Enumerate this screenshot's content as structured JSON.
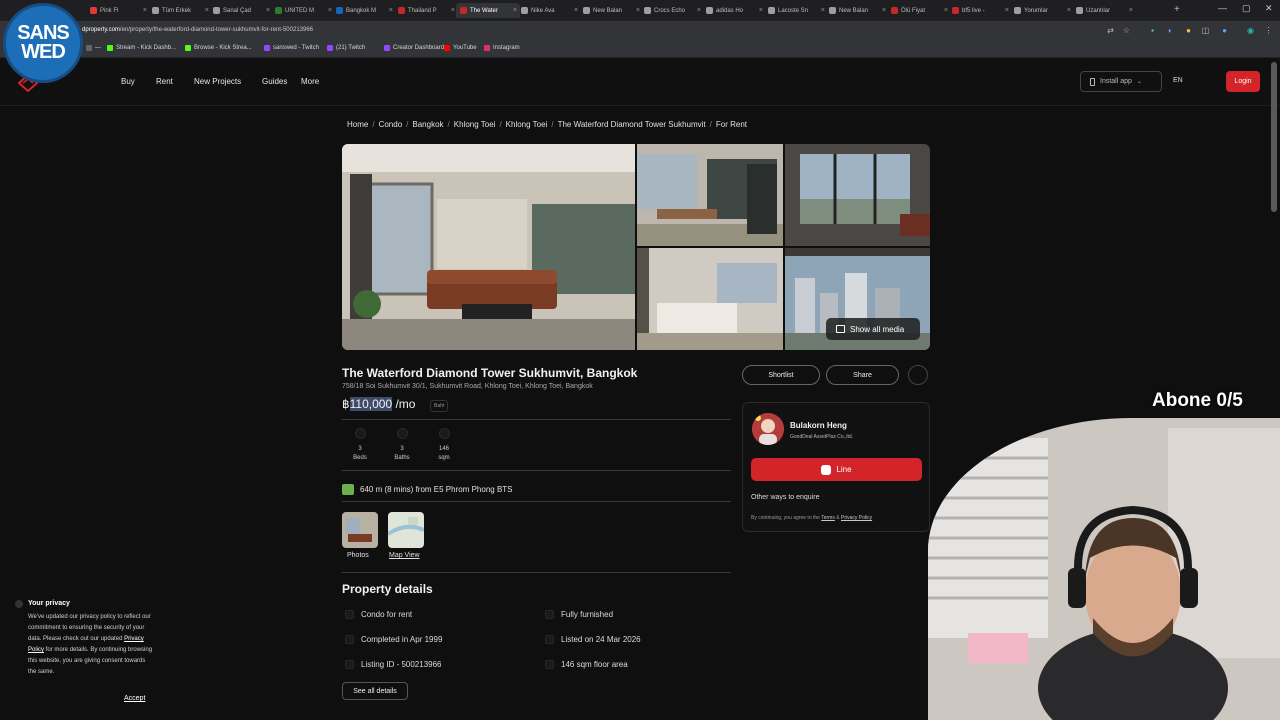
{
  "browser": {
    "tabs": [
      {
        "label": "Pink Fl",
        "color": "#e53935"
      },
      {
        "label": "Tüm Erkek",
        "color": "#9e9e9e"
      },
      {
        "label": "Sanal Çad",
        "color": "#9e9e9e"
      },
      {
        "label": "UNITED M",
        "color": "#2e7d32"
      },
      {
        "label": "Bangkok M",
        "color": "#1565c0"
      },
      {
        "label": "Thailand P",
        "color": "#c62828"
      },
      {
        "label": "The Water",
        "color": "#c62828",
        "active": true
      },
      {
        "label": "Nike Ava",
        "color": "#9e9e9e"
      },
      {
        "label": "New Balan",
        "color": "#9e9e9e"
      },
      {
        "label": "Crocs Echo",
        "color": "#9e9e9e"
      },
      {
        "label": "adidas Ho",
        "color": "#9e9e9e"
      },
      {
        "label": "Lacoste Sn",
        "color": "#9e9e9e"
      },
      {
        "label": "New Balan",
        "color": "#9e9e9e"
      },
      {
        "label": "Ölü Fiyat",
        "color": "#c62828"
      },
      {
        "label": "bf5 live -",
        "color": "#c62828"
      },
      {
        "label": "Yorumlar",
        "color": "#9e9e9e"
      },
      {
        "label": "Uzantılar",
        "color": "#9e9e9e"
      }
    ],
    "url_domain": "dproperty.com",
    "url_path": "/en/property/the-waterford-diamond-tower-sukhumvit-for-rent-500213966",
    "bookmarks": [
      {
        "label": "—",
        "color": "#666"
      },
      {
        "label": "Stream - Kick Dashb...",
        "color": "#53fc18"
      },
      {
        "label": "Browse - Kick Strea...",
        "color": "#53fc18"
      },
      {
        "label": "sanswed - Twitch",
        "color": "#9146ff"
      },
      {
        "label": "(21) Twitch",
        "color": "#9146ff"
      },
      {
        "label": "Creator Dashboard",
        "color": "#9146ff"
      },
      {
        "label": "YouTube",
        "color": "#ff0000"
      },
      {
        "label": "Instagram",
        "color": "#e1306c"
      }
    ]
  },
  "overlay": {
    "logo_line1": "SANS",
    "logo_line2": "WED",
    "subs_counter": "Abone 0/5"
  },
  "header": {
    "nav": [
      "Buy",
      "Rent",
      "New Projects",
      "Guides",
      "More"
    ],
    "install_app": "Install app",
    "lang": "EN",
    "login": "Login",
    "accent": "#d3242a"
  },
  "breadcrumb": [
    "Home",
    "Condo",
    "Bangkok",
    "Khlong Toei",
    "Khlong Toei",
    "The Waterford Diamond Tower Sukhumvit",
    "For Rent"
  ],
  "gallery": {
    "show_all_media": "Show all media"
  },
  "listing": {
    "title": "The Waterford Diamond Tower Sukhumvit, Bangkok",
    "address": "758/18 Soi Sukhumvit 30/1, Sukhumvit Road, Khlong Toei, Khlong Toei, Bangkok",
    "price_symbol": "฿",
    "price_value": "110,000",
    "price_suffix": " /mo",
    "currency_tag": "Baht",
    "features": [
      {
        "value": "3",
        "label": "Beds",
        "icon": "bed-icon"
      },
      {
        "value": "3",
        "label": "Baths",
        "icon": "bath-icon"
      },
      {
        "value": "146",
        "label": "sqm",
        "icon": "area-icon"
      }
    ],
    "transit": "640 m (8 mins) from E5 Phrom Phong BTS",
    "thumbs": [
      {
        "label": "Photos"
      },
      {
        "label": "Map View"
      }
    ]
  },
  "actions": {
    "shortlist": "Shortlist",
    "share": "Share"
  },
  "agent": {
    "name": "Bulakorn Heng",
    "company": "GoodDeal AssetPlus Co.,ltd.",
    "line_button": "Line",
    "other_ways": "Other ways to enquire",
    "terms_prefix": "By continuing, you agree to the ",
    "terms_link": "Terms",
    "terms_and": " & ",
    "privacy_link": "Privacy Policy"
  },
  "details": {
    "title": "Property details",
    "items": [
      "Condo for rent",
      "Fully furnished",
      "Completed in Apr 1999",
      "Listed on 24 Mar 2026",
      "Listing ID - 500213966",
      "146 sqm floor area"
    ],
    "see_all": "See all details"
  },
  "privacy_notice": {
    "title": "Your privacy",
    "body_1": "We've updated our privacy policy to reflect our commitment to ensuring the security of your data. Please check out our updated ",
    "link": "Privacy Policy",
    "body_2": " for more details. By continuing browsing this website, you are giving consent towards the same.",
    "accept": "Accept"
  }
}
